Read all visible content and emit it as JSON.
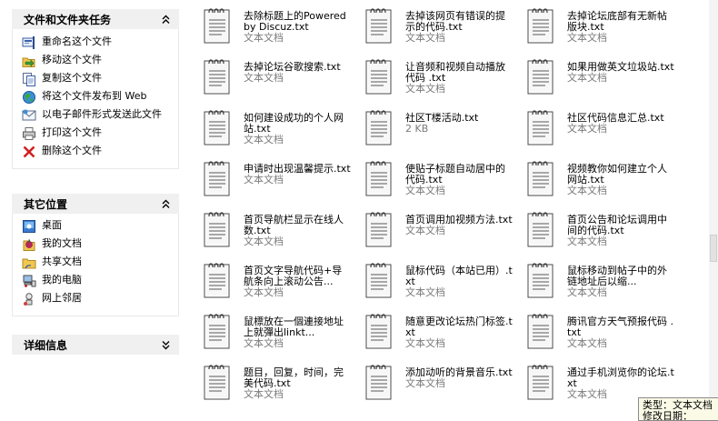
{
  "tasks": {
    "title": "文件和文件夹任务",
    "items": [
      {
        "label": "重命名这个文件",
        "icon": "rename-icon"
      },
      {
        "label": "移动这个文件",
        "icon": "move-icon"
      },
      {
        "label": "复制这个文件",
        "icon": "copy-icon"
      },
      {
        "label": "将这个文件发布到 Web",
        "icon": "globe-icon"
      },
      {
        "label": "以电子邮件形式发送此文件",
        "icon": "email-icon"
      },
      {
        "label": "打印这个文件",
        "icon": "printer-icon"
      },
      {
        "label": "删除这个文件",
        "icon": "delete-icon"
      }
    ]
  },
  "places": {
    "title": "其它位置",
    "items": [
      {
        "label": "桌面",
        "icon": "desktop-icon"
      },
      {
        "label": "我的文档",
        "icon": "my-documents-icon"
      },
      {
        "label": "共享文档",
        "icon": "shared-folder-icon"
      },
      {
        "label": "我的电脑",
        "icon": "my-computer-icon"
      },
      {
        "label": "网上邻居",
        "icon": "network-icon"
      }
    ]
  },
  "details": {
    "title": "详细信息"
  },
  "files": [
    {
      "name": "去除标题上的Powered by Discuz.txt",
      "type": "文本文档"
    },
    {
      "name": "去掉该网页有错误的提示的代码.txt",
      "type": "文本文档"
    },
    {
      "name": "去掉论坛底部有无新帖版块.txt",
      "type": "文本文档"
    },
    {
      "name": "去掉论坛谷歌搜索.txt",
      "type": "文本文档"
    },
    {
      "name": "让音频和视频自动播放代码 .txt",
      "type": "文本文档"
    },
    {
      "name": "如果用做英文垃圾站.txt",
      "type": "文本文档"
    },
    {
      "name": "如何建设成功的个人网站.txt",
      "type": "文本文档"
    },
    {
      "name": "社区T楼活动.txt",
      "type": "2 KB"
    },
    {
      "name": "社区代码信息汇总.txt",
      "type": "文本文档"
    },
    {
      "name": "申请时出现温馨提示.txt",
      "type": "文本文档"
    },
    {
      "name": "使贴子标题自动居中的代码.txt",
      "type": "文本文档"
    },
    {
      "name": "视频教你如何建立个人网站.txt",
      "type": "文本文档"
    },
    {
      "name": "首页导航栏显示在线人数.txt",
      "type": "文本文档"
    },
    {
      "name": "首页调用加视频方法.txt",
      "type": "文本文档"
    },
    {
      "name": "首页公告和论坛调用中间的代码.txt",
      "type": "文本文档"
    },
    {
      "name": "首页文字导航代码+导航条向上滚动公告...",
      "type": "文本文档"
    },
    {
      "name": "鼠标代码（本站已用）.txt",
      "type": "文本文档"
    },
    {
      "name": "鼠标移动到帖子中的外链地址后以缩...",
      "type": "文本文档"
    },
    {
      "name": "鼠標放在一個連接地址上就彈出linkt...",
      "type": "文本文档"
    },
    {
      "name": "随意更改论坛热门标签.txt",
      "type": "文本文档"
    },
    {
      "name": "腾讯官方天气预报代码 .txt",
      "type": "文本文档"
    },
    {
      "name": "题目，回复，时间，完美代码.txt",
      "type": "文本文档"
    },
    {
      "name": "添加动听的背景音乐.txt",
      "type": "文本文档"
    },
    {
      "name": "通过手机浏览你的论坛.txt",
      "type": "文本文档"
    }
  ],
  "tooltip": {
    "text": "类型：文本文档 修改日期："
  },
  "colors": {
    "header_bg": "#f0f0f0",
    "type_text": "#7a7a7a",
    "tooltip_bg": "#fafae6"
  }
}
